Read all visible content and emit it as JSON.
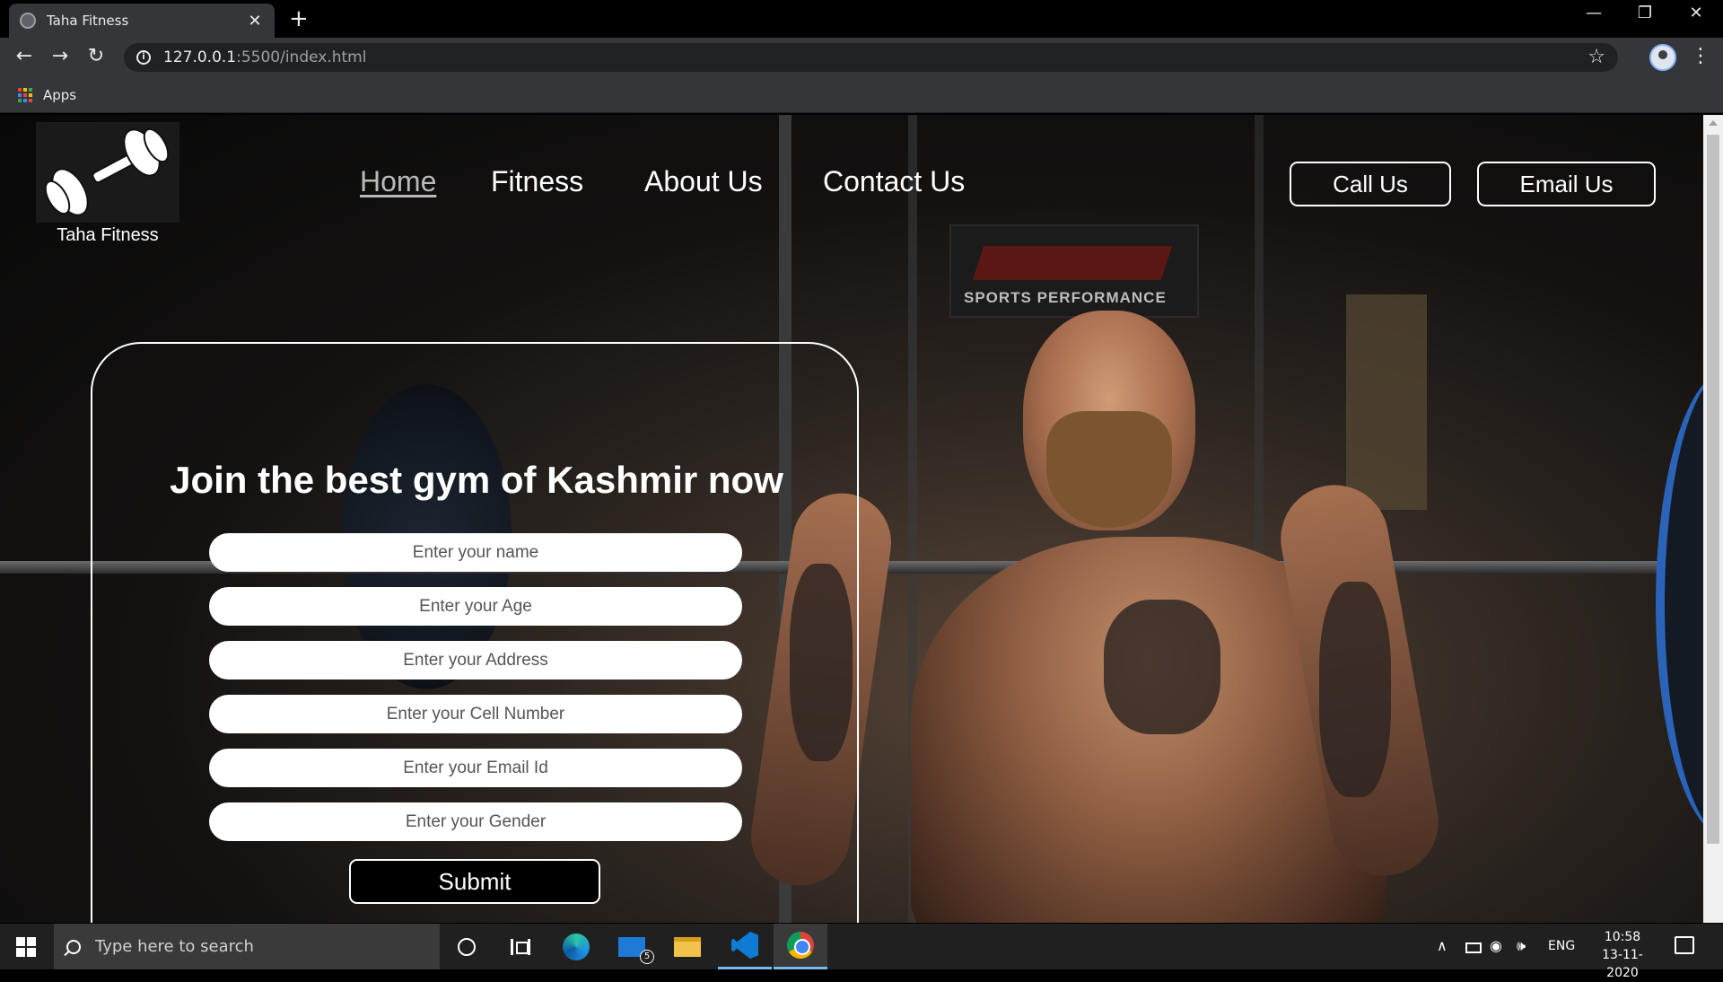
{
  "browser": {
    "tab_title": "Taha Fitness",
    "tab_close": "✕",
    "new_tab": "+",
    "url_host": "127.0.0.1",
    "url_path": ":5500/index.html",
    "bookmarks_apps": "Apps",
    "window_minimize": "—",
    "window_restore": "❐",
    "window_close": "✕",
    "back": "←",
    "forward": "→",
    "reload": "↻",
    "star": "☆",
    "menu": "⋮"
  },
  "site": {
    "brand": "Taha Fitness",
    "nav": [
      "Home",
      "Fitness",
      "About Us",
      "Contact Us"
    ],
    "active_nav": "Home",
    "header_buttons": [
      "Call Us",
      "Email Us"
    ],
    "background_sign": "SPORTS PERFORMANCE"
  },
  "form": {
    "title": "Join the best gym of Kashmir now",
    "fields": [
      "Enter your name",
      "Enter your Age",
      "Enter your Address",
      "Enter your Cell Number",
      "Enter your Email Id",
      "Enter your Gender"
    ],
    "submit": "Submit"
  },
  "taskbar": {
    "search_placeholder": "Type here to search",
    "mail_badge": "5",
    "language": "ENG",
    "time": "10:58",
    "date": "13-11-2020",
    "tray_chevron": "∧",
    "tray_network": "◉",
    "tray_volume": "🕪"
  },
  "colors": {
    "page_background": "#000000",
    "accent_text": "#ffffff",
    "active_nav": "#b9b9b9",
    "browser_chrome": "#35363a",
    "taskbar": "#202020"
  }
}
